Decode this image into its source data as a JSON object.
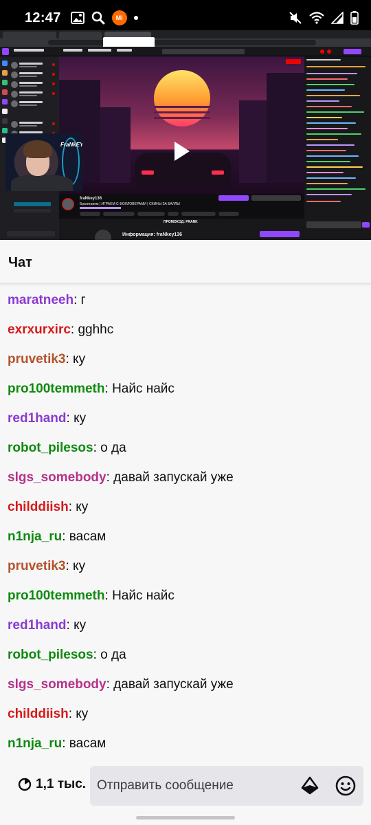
{
  "status_bar": {
    "time": "12:47",
    "icons": [
      "gallery-icon",
      "search-icon",
      "mi-icon",
      "notification-dot",
      "mute-icon",
      "wifi-icon",
      "signal-icon",
      "battery-icon"
    ],
    "mi_label": "Mi"
  },
  "stream": {
    "channel_name": "fraNkey136",
    "stream_title": "Братиграем | ИГРАЕМ С ФОЛЛОВЕРАМИ | СКИНЫ ЗА БАЛЛЫ",
    "promo_text": "ПРОМОКОД: FRANK",
    "about_text": "Информация: fraNkey136"
  },
  "chat": {
    "title": "Чат",
    "messages": [
      {
        "user": "maratneeh",
        "text": "г",
        "color": "#8a3ad0"
      },
      {
        "user": "exrxurxirc",
        "text": "gghhc",
        "color": "#d61a1a"
      },
      {
        "user": "pruvetik3",
        "text": "ку",
        "color": "#b4532a"
      },
      {
        "user": "pro100temmeth",
        "text": "Найс найс",
        "color": "#0f8a0f"
      },
      {
        "user": "red1hand",
        "text": "ку",
        "color": "#8a3ad0"
      },
      {
        "user": "robot_pilesos",
        "text": "о да",
        "color": "#0f8a0f"
      },
      {
        "user": "slgs_somebody",
        "text": "давай запускай уже",
        "color": "#b5338a"
      },
      {
        "user": "childdiish",
        "text": "ку",
        "color": "#d61a1a"
      },
      {
        "user": "n1nja_ru",
        "text": "васам",
        "color": "#0f8a0f"
      },
      {
        "user": "pruvetik3",
        "text": "ку",
        "color": "#b4532a"
      },
      {
        "user": "pro100temmeth",
        "text": "Найс найс",
        "color": "#0f8a0f"
      },
      {
        "user": "red1hand",
        "text": "ку",
        "color": "#8a3ad0"
      },
      {
        "user": "robot_pilesos",
        "text": "о да",
        "color": "#0f8a0f"
      },
      {
        "user": "slgs_somebody",
        "text": "давай запускай уже",
        "color": "#b5338a"
      },
      {
        "user": "childdiish",
        "text": "ку",
        "color": "#d61a1a"
      },
      {
        "user": "n1nja_ru",
        "text": "васам",
        "color": "#0f8a0f"
      }
    ]
  },
  "input_bar": {
    "viewer_count": "1,1 тыс.",
    "placeholder": "Отправить сообщение",
    "bits_icon": "bits-icon",
    "emote_icon": "emote-icon"
  },
  "colors": {
    "twitch_purple": "#9147ff",
    "live_red": "#eb0400",
    "background": "#f7f7f8"
  }
}
